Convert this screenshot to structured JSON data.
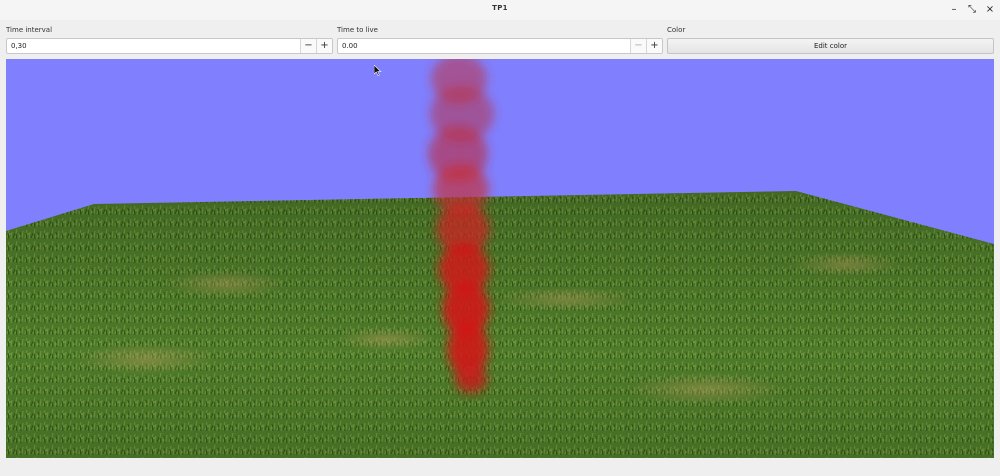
{
  "window": {
    "title": "TP1"
  },
  "controls": {
    "time_interval": {
      "label": "Time interval",
      "value": "0,30"
    },
    "time_to_live": {
      "label": "Time to live",
      "value": "0.00"
    },
    "color": {
      "label": "Color",
      "button_label": "Edit color"
    },
    "minus": "−",
    "plus": "+"
  },
  "window_buttons": {
    "minimize": "–",
    "restore": "⤡",
    "close": "×"
  },
  "scene": {
    "sky_color": "#8080ff",
    "grass_color": "#4e7a2a",
    "particle_color": "#d01818"
  }
}
